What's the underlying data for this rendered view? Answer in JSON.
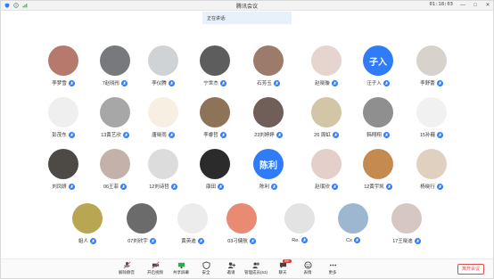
{
  "window": {
    "title": "腾讯会议",
    "time": "01:18:03"
  },
  "titlebar_buttons": [
    "—",
    "□",
    "✕"
  ],
  "speaking": "正在讲话:",
  "participants": [
    {
      "name": "李梦雪",
      "color": "#b57a6c"
    },
    {
      "name": "7赵晓彤",
      "color": "#77797d"
    },
    {
      "name": "李仪腾",
      "color": "#cfd3d6"
    },
    {
      "name": "宁世杰",
      "color": "#5d5d5d"
    },
    {
      "name": "石芳玉",
      "color": "#9c7b6a"
    },
    {
      "name": "赵晓璇",
      "color": "#e6d5cf"
    },
    {
      "name": "汪子入",
      "color": "#2f7cf6",
      "text": "子入"
    },
    {
      "name": "李舒蕾",
      "color": "#d8d2cc"
    },
    {
      "name": "彭茂东",
      "color": "#efefef"
    },
    {
      "name": "13黄艺欣",
      "color": "#a7a7a7"
    },
    {
      "name": "唐晓雨",
      "color": "#f7efe2"
    },
    {
      "name": "李睿哲",
      "color": "#8d7358"
    },
    {
      "name": "23刘婷婷",
      "color": "#6f5f58"
    },
    {
      "name": "26 周虹",
      "color": "#d2c6a7"
    },
    {
      "name": "韩翔翔",
      "color": "#8f8f8f"
    },
    {
      "name": "15孙巍",
      "color": "#f1f1f1"
    },
    {
      "name": "刘凤妍",
      "color": "#4d4a46"
    },
    {
      "name": "06王菲",
      "color": "#c4b2aa"
    },
    {
      "name": "12刘诗哲",
      "color": "#dcdcdc"
    },
    {
      "name": "康田",
      "color": "#2b2b2b"
    },
    {
      "name": "陈利",
      "color": "#2f7cf6",
      "text": "陈利"
    },
    {
      "name": "赵珉欣",
      "color": "#e5cfcb"
    },
    {
      "name": "12黄宇凯",
      "color": "#c58a4f"
    },
    {
      "name": "杨晓行",
      "color": "#e0d0c0"
    },
    {
      "name": "姐人",
      "color": "#b9a653"
    },
    {
      "name": "07刘欣宇",
      "color": "#6b6b6b"
    },
    {
      "name": "黄英迪",
      "color": "#ececec"
    },
    {
      "name": "03刁健航",
      "color": "#e98a73"
    },
    {
      "name": "Re.",
      "color": "#e3e3e3"
    },
    {
      "name": "Cx",
      "color": "#9eb7d0"
    },
    {
      "name": "17王晓迪",
      "color": "#d6c7c4"
    }
  ],
  "toolbar": [
    {
      "name": "mute",
      "label": "解除静音",
      "icon": "mic-icon"
    },
    {
      "name": "video",
      "label": "开启视频",
      "icon": "camera-icon"
    },
    {
      "name": "share",
      "label": "共享屏幕",
      "icon": "screen-share-icon"
    },
    {
      "name": "security",
      "label": "安全",
      "icon": "shield-icon"
    },
    {
      "name": "invite",
      "label": "邀请",
      "icon": "invite-icon"
    },
    {
      "name": "members",
      "label": "管理成员(63)",
      "icon": "members-icon"
    },
    {
      "name": "chat",
      "label": "聊天",
      "icon": "chat-icon",
      "badge": "99+"
    },
    {
      "name": "expression",
      "label": "表情",
      "icon": "emoji-icon"
    },
    {
      "name": "more",
      "label": "更多",
      "icon": "more-icon"
    }
  ],
  "leave_label": "离开会议",
  "colors": {
    "accent": "#2f7cf6",
    "danger": "#e24b4b"
  }
}
